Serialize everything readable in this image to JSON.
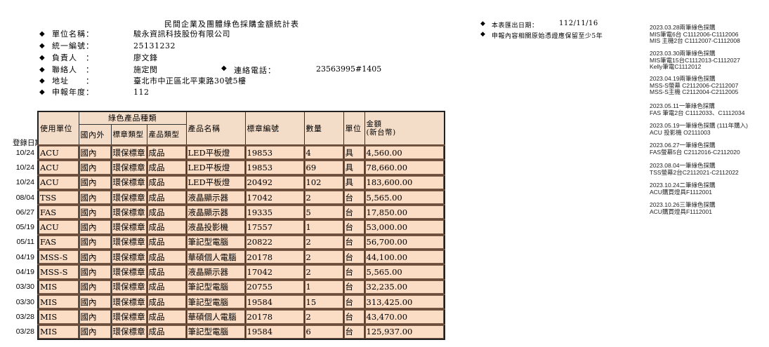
{
  "title": "民間企業及團體綠色採購金額統計表",
  "header": {
    "rows": [
      {
        "label": "單位名稱：",
        "value": "駿永資訊科技股份有限公司"
      },
      {
        "label": "統一編號：",
        "value": "25131232"
      },
      {
        "label": "負責人　：",
        "value": "廖文鋒"
      },
      {
        "label": "聯絡人　：",
        "value": "施定閔"
      },
      {
        "label": "地址　　：",
        "value": "臺北市中正區北平東路30號5樓"
      },
      {
        "label": "申報年度：",
        "value": "112"
      }
    ],
    "phone_label": "連絡電話：",
    "phone_value": "23563995#1405",
    "diamond": "◆"
  },
  "notes": {
    "export_date_label": "本表匯出日期：",
    "export_date_value": "112/11/16",
    "retention_note": "申報內容相關原始憑證應保留至少5年"
  },
  "side_notes": [
    [
      "2023.03.28兩筆綠色採購",
      "MIS筆電6台 C1112006-C1112006",
      "MIS 主機2台 C1112007-C1112008"
    ],
    [
      "2023.03.30兩筆綠色採購",
      "MIS筆電15台C1112013-C1112027",
      "Kelly筆電C1112012"
    ],
    [
      "2023.04.19兩筆綠色採購",
      "MSS-S螢幕 C2112006-C2112007",
      "MSS-S主機 C2112004-C2112005"
    ],
    [
      "2023.05.11一筆綠色採購",
      "FAS 筆電2台 C1112033、C1112034"
    ],
    [
      "2023.05.19一筆綠色採購 (111年購入)",
      "ACU 投影機 O2111003"
    ],
    [
      "2023.06.27一筆綠色採購",
      "FAS螢幕5台 C2112016-C2112020"
    ],
    [
      "2023.08.04一筆綠色採購",
      "TSS螢幕2台C2112021-C2112022"
    ],
    [
      "2023.10.24二筆綠色採購",
      "ACU購買燈具F1112001"
    ],
    [
      "2023.10.26三筆綠色採購",
      "ACU購買燈具F1112001"
    ]
  ],
  "table": {
    "reg_date_label": "登錄日期",
    "headers": {
      "unit": "使用單位",
      "category_group": "綠色產品種類",
      "domestic": "國內外",
      "label_type": "標章類型",
      "product_type": "產品類型",
      "product_name": "產品名稱",
      "label_no": "標章編號",
      "qty": "數量",
      "uom": "單位",
      "amount": "金額\n(新台幣)"
    },
    "rows": [
      {
        "date": "10/24",
        "unit": "ACU",
        "domestic": "國內",
        "label_type": "環保標章",
        "product_type": "成品",
        "product_name": "LED平板燈",
        "label_no": "19853",
        "qty": "4",
        "uom": "具",
        "amount": "4,560.00"
      },
      {
        "date": "10/24",
        "unit": "ACU",
        "domestic": "國內",
        "label_type": "環保標章",
        "product_type": "成品",
        "product_name": "LED平板燈",
        "label_no": "19853",
        "qty": "69",
        "uom": "具",
        "amount": "78,660.00"
      },
      {
        "date": "10/24",
        "unit": "ACU",
        "domestic": "國內",
        "label_type": "環保標章",
        "product_type": "成品",
        "product_name": "LED平板燈",
        "label_no": "20492",
        "qty": "102",
        "uom": "具",
        "amount": "183,600.00"
      },
      {
        "date": "08/04",
        "unit": "TSS",
        "domestic": "國內",
        "label_type": "環保標章",
        "product_type": "成品",
        "product_name": "液晶顯示器",
        "label_no": "17042",
        "qty": "2",
        "uom": "台",
        "amount": "5,565.00"
      },
      {
        "date": "06/27",
        "unit": "FAS",
        "domestic": "國內",
        "label_type": "環保標章",
        "product_type": "成品",
        "product_name": "液晶顯示器",
        "label_no": "19335",
        "qty": "5",
        "uom": "台",
        "amount": "17,850.00"
      },
      {
        "date": "05/19",
        "unit": "ACU",
        "domestic": "國內",
        "label_type": "環保標章",
        "product_type": "成品",
        "product_name": "液晶投影機",
        "label_no": "17557",
        "qty": "1",
        "uom": "台",
        "amount": "53,000.00"
      },
      {
        "date": "05/11",
        "unit": "FAS",
        "domestic": "國內",
        "label_type": "環保標章",
        "product_type": "成品",
        "product_name": "筆記型電腦",
        "label_no": "20822",
        "qty": "2",
        "uom": "台",
        "amount": "56,700.00"
      },
      {
        "date": "04/19",
        "unit": "MSS-S",
        "domestic": "國內",
        "label_type": "環保標章",
        "product_type": "成品",
        "product_name": "華碩個人電腦",
        "label_no": "20178",
        "qty": "2",
        "uom": "台",
        "amount": "44,100.00"
      },
      {
        "date": "04/19",
        "unit": "MSS-S",
        "domestic": "國內",
        "label_type": "環保標章",
        "product_type": "成品",
        "product_name": "液晶顯示器",
        "label_no": "17042",
        "qty": "2",
        "uom": "台",
        "amount": "5,565.00"
      },
      {
        "date": "03/30",
        "unit": "MIS",
        "domestic": "國內",
        "label_type": "環保標章",
        "product_type": "成品",
        "product_name": "筆記型電腦",
        "label_no": "20755",
        "qty": "1",
        "uom": "台",
        "amount": "32,235.00"
      },
      {
        "date": "03/30",
        "unit": "MIS",
        "domestic": "國內",
        "label_type": "環保標章",
        "product_type": "成品",
        "product_name": "筆記型電腦",
        "label_no": "19584",
        "qty": "15",
        "uom": "台",
        "amount": "313,425.00"
      },
      {
        "date": "03/28",
        "unit": "MIS",
        "domestic": "國內",
        "label_type": "環保標章",
        "product_type": "成品",
        "product_name": "華碩個人電腦",
        "label_no": "20178",
        "qty": "2",
        "uom": "台",
        "amount": "43,470.00"
      },
      {
        "date": "03/28",
        "unit": "MIS",
        "domestic": "國內",
        "label_type": "環保標章",
        "product_type": "成品",
        "product_name": "筆記型電腦",
        "label_no": "19584",
        "qty": "6",
        "uom": "台",
        "amount": "125,937.00"
      }
    ]
  }
}
